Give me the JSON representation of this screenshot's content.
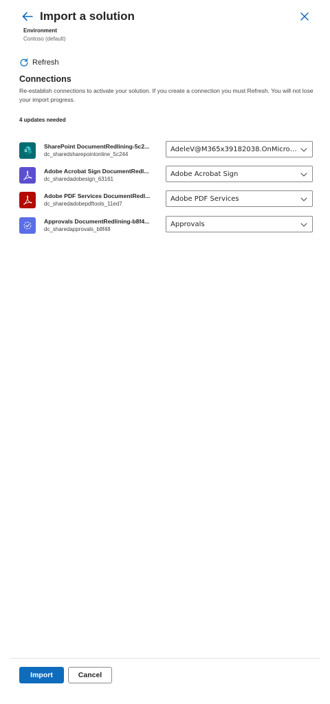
{
  "header": {
    "title": "Import a solution"
  },
  "environment": {
    "label": "Environment",
    "value": "Contoso (default)"
  },
  "refresh": {
    "label": "Refresh"
  },
  "connections": {
    "title": "Connections",
    "description": "Re-establish connections to activate your solution. If you create a connection you must Refresh. You will not lose your import progress.",
    "updates_needed": "4 updates needed",
    "items": [
      {
        "name": "SharePoint DocumentRedlining-5c2...",
        "id": "dc_sharedsharepointonline_5c244",
        "selected": "AdeleV@M365x39182038.OnMicroso...",
        "icon": "sharepoint-icon",
        "icon_color": "#036c70"
      },
      {
        "name": "Adobe Acrobat Sign DocumentRedl...",
        "id": "dc_sharedadobesign_63161",
        "selected": "Adobe Acrobat Sign",
        "icon": "adobe-acrobat-sign-icon",
        "icon_color": "#5c4fcf"
      },
      {
        "name": "Adobe PDF Services DocumentRedl...",
        "id": "dc_sharedadobepdftools_11ed7",
        "selected": "Adobe PDF Services",
        "icon": "adobe-pdf-services-icon",
        "icon_color": "#b30b00"
      },
      {
        "name": "Approvals DocumentRedlining-b8f4...",
        "id": "dc_sharedapprovals_b8f48",
        "selected": "Approvals",
        "icon": "approvals-icon",
        "icon_color": "#5b6ee8"
      }
    ]
  },
  "footer": {
    "import_label": "Import",
    "cancel_label": "Cancel"
  },
  "colors": {
    "accent": "#0f6cbd"
  }
}
